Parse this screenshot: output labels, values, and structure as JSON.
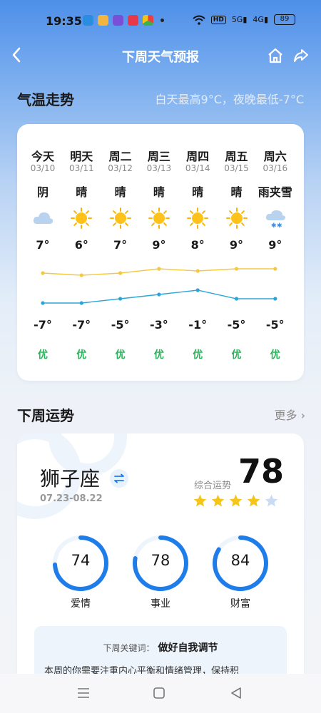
{
  "status": {
    "time": "19:35",
    "hd": "HD",
    "sig1": "5G",
    "sig2": "4G",
    "battery": "89"
  },
  "nav": {
    "title": "下周天气预报"
  },
  "forecast": {
    "section_title": "气温走势",
    "summary": "白天最高9°C，夜晚最低-7°C",
    "days": [
      {
        "name": "今天",
        "date": "03/10",
        "cond": "阴",
        "icon": "cloudy-icon",
        "high": "7°",
        "low": "-7°",
        "aqi": "优"
      },
      {
        "name": "明天",
        "date": "03/11",
        "cond": "晴",
        "icon": "sunny-icon",
        "high": "6°",
        "low": "-7°",
        "aqi": "优"
      },
      {
        "name": "周二",
        "date": "03/12",
        "cond": "晴",
        "icon": "sunny-icon",
        "high": "7°",
        "low": "-5°",
        "aqi": "优"
      },
      {
        "name": "周三",
        "date": "03/13",
        "cond": "晴",
        "icon": "sunny-icon",
        "high": "9°",
        "low": "-3°",
        "aqi": "优"
      },
      {
        "name": "周四",
        "date": "03/14",
        "cond": "晴",
        "icon": "sunny-icon",
        "high": "8°",
        "low": "-1°",
        "aqi": "优"
      },
      {
        "name": "周五",
        "date": "03/15",
        "cond": "晴",
        "icon": "sunny-icon",
        "high": "9°",
        "low": "-5°",
        "aqi": "优"
      },
      {
        "name": "周六",
        "date": "03/16",
        "cond": "雨夹雪",
        "icon": "sleet-icon",
        "high": "9°",
        "low": "-5°",
        "aqi": "优"
      }
    ],
    "chart_data": {
      "type": "line",
      "categories": [
        "03/10",
        "03/11",
        "03/12",
        "03/13",
        "03/14",
        "03/15",
        "03/16"
      ],
      "series": [
        {
          "values": [
            7,
            6,
            7,
            9,
            8,
            9,
            9
          ],
          "color": "#f5c842"
        },
        {
          "values": [
            -7,
            -7,
            -5,
            -3,
            -1,
            -5,
            -5
          ],
          "color": "#2aa7d8"
        }
      ]
    }
  },
  "fortune": {
    "section_title": "下周运势",
    "more_label": "更多",
    "sign": "狮子座",
    "dates": "07.23-08.22",
    "overall_label": "综合运势",
    "overall_score": "78",
    "stars": 4,
    "stars_max": 5,
    "gauges": [
      {
        "label": "爱情",
        "value": "74"
      },
      {
        "label": "事业",
        "value": "78"
      },
      {
        "label": "财富",
        "value": "84"
      }
    ],
    "keyword_label": "下周关键词：",
    "keyword_value": "做好自我调节",
    "keyword_text": "本周的你需要注重内心平衡和情绪管理，保持积"
  },
  "colors": {
    "accent": "#1e7de8",
    "star": "#f5c518",
    "good": "#2bb25a"
  }
}
